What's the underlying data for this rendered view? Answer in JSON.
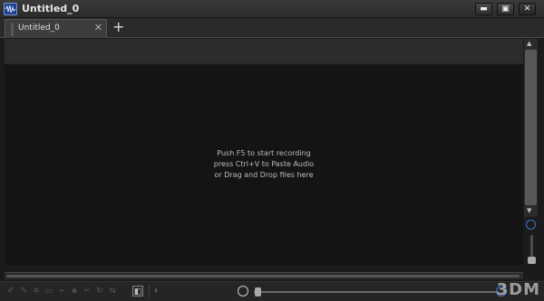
{
  "window": {
    "title": "Untitled_0",
    "minimize_glyph": "▬",
    "restore_glyph": "▣",
    "close_glyph": "✕"
  },
  "tabs": [
    {
      "label": "Untitled_0",
      "close_glyph": "✕"
    }
  ],
  "new_tab_glyph": "+",
  "hint": {
    "line1": "Push F5 to start recording",
    "line2": "press Ctrl+V to Paste Audio",
    "line3": "or Drag and Drop files here"
  },
  "vscroll": {
    "up_glyph": "▲",
    "down_glyph": "▼"
  },
  "toolbar": {
    "tools": [
      "✐",
      "✎",
      "≋",
      "▭",
      "⌁",
      "◈",
      "✂",
      "↻",
      "⇆",
      "◧"
    ],
    "scroll_left_glyph": "‹"
  },
  "watermark": "3DM"
}
